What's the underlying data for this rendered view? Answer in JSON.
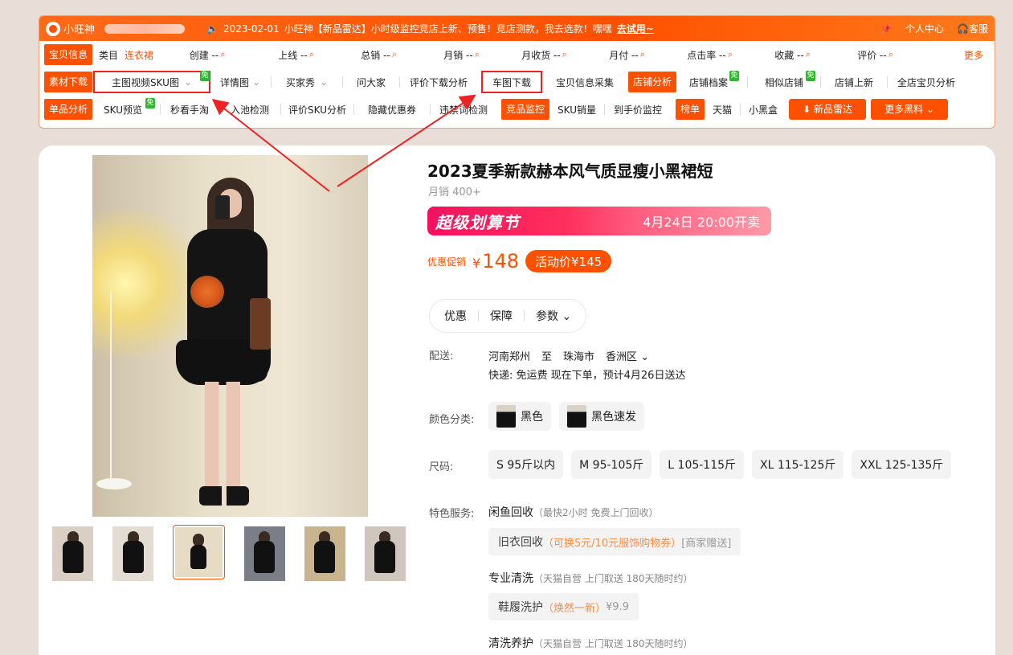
{
  "toolbar": {
    "brand": "小旺神",
    "notice_date": "2023-02-01",
    "notice_text": "小旺神【新品雷达】小时级监控竞店上新、预售！竞店测款，我去选款！嘿嘿",
    "notice_link": "去试用~",
    "pin_icon": "pin-icon",
    "personal": "个人中心",
    "service": "客服",
    "row1": {
      "label": "宝贝信息",
      "category_key": "类目",
      "category_val": "连衣裙",
      "items": [
        "创建 --",
        "上线 --",
        "总销 --",
        "月销 --",
        "月收货 --",
        "月付 --",
        "点击率 --",
        "收藏 --",
        "评价 --"
      ],
      "more": "更多"
    },
    "row2": {
      "label": "素材下载",
      "items": [
        "主图视频SKU图",
        "详情图",
        "买家秀",
        "问大家",
        "评价下载分析",
        "车图下载",
        "宝贝信息采集"
      ],
      "shop_label": "店铺分析",
      "shop_items": [
        "店铺档案",
        "相似店铺",
        "店铺上新",
        "全店宝贝分析"
      ],
      "free_badge": "免"
    },
    "row3": {
      "label": "单品分析",
      "items": [
        "SKU预览",
        "秒看手淘",
        "入池检测",
        "评价SKU分析",
        "隐藏优惠券",
        "违禁词检测"
      ],
      "monitor_label": "竞品监控",
      "monitor_items": [
        "SKU销量",
        "到手价监控"
      ],
      "rank_label": "榜单",
      "rank_items": [
        "天猫",
        "小黑盒"
      ],
      "radar_btn": "新品雷达",
      "more_btn": "更多黑料"
    }
  },
  "product": {
    "title": "2023夏季新款赫本风气质显瘦小黑裙短",
    "sales": "月销 400+",
    "banner_big": "超级划算节",
    "banner_time": "4月24日 20:00开卖",
    "price_label": "优惠促销",
    "price_symbol": "¥",
    "price": "148",
    "activity_price": "活动价¥145",
    "tabs": [
      "优惠",
      "保障",
      "参数"
    ],
    "delivery_label": "配送:",
    "delivery_from": "河南郑州",
    "delivery_to_word": "至",
    "delivery_city": "珠海市",
    "delivery_district": "香洲区",
    "delivery_line2": "快递: 免运费   现在下单，预计4月26日送达",
    "color_label": "颜色分类:",
    "colors": [
      "黑色",
      "黑色速发"
    ],
    "size_label": "尺码:",
    "sizes": [
      "S 95斤以内",
      "M 95-105斤",
      "L 105-115斤",
      "XL 115-125斤",
      "XXL 125-135斤"
    ],
    "service_label": "特色服务:",
    "svc1_title": "闲鱼回收",
    "svc1_sub": "（最快2小时 免费上门回收）",
    "svc1_chip": "旧衣回收",
    "svc1_chip_or": "（可换5元/10元服饰购物券）",
    "svc1_chip_gr": "[商家赠送]",
    "svc2_title": "专业清洗",
    "svc2_sub": "（天猫自营 上门取送 180天随时约）",
    "svc2_chip": "鞋履洗护",
    "svc2_chip_or": "（焕然一新）",
    "svc2_chip_gr": "¥9.9",
    "svc3_title": "清洗养护",
    "svc3_sub": "（天猫自营 上门取送 180天随时约）"
  },
  "colors": {
    "accent": "#ff5000",
    "highlight": "#e22222",
    "free_badge": "#2db82d",
    "banner": "#f3115f"
  }
}
